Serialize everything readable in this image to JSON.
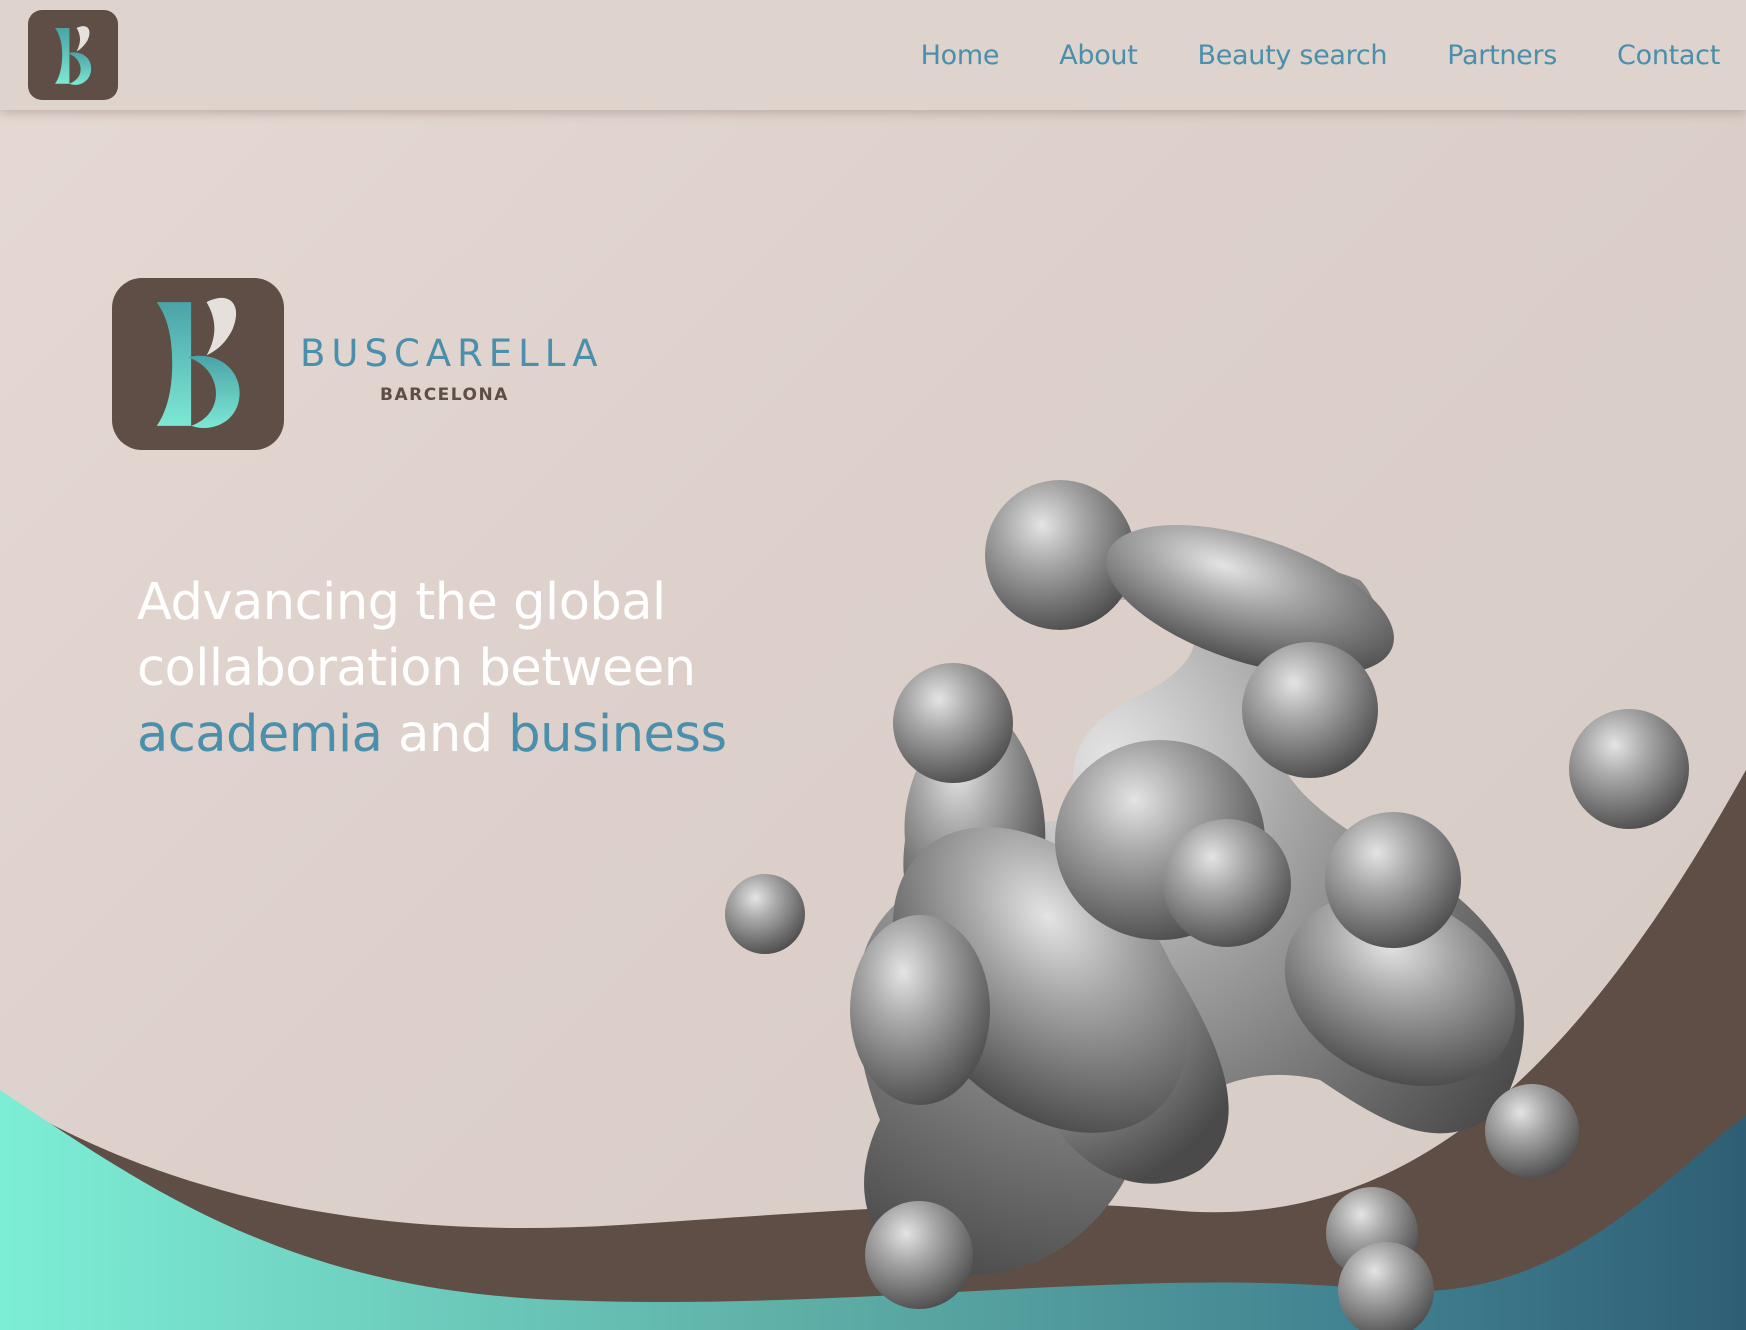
{
  "header": {
    "logo_icon": "buscarella-b-monogram-icon",
    "nav": [
      {
        "label": "Home"
      },
      {
        "label": "About"
      },
      {
        "label": "Beauty search"
      },
      {
        "label": "Partners"
      },
      {
        "label": "Contact"
      }
    ]
  },
  "hero": {
    "logo_icon": "buscarella-b-monogram-icon",
    "brand_name": "BUSCARELLA",
    "brand_sub": "BARCELONA",
    "headline": {
      "part1": "Advancing the global collaboration between ",
      "accent1": "academia",
      "part2": " and ",
      "accent2": "business"
    },
    "art": "abstract-grey-metaball-sculpture"
  },
  "colors": {
    "accent": "#4a8fab",
    "brown": "#5e4e45",
    "background": "#ddd0ca",
    "mint": "#7de8d4",
    "headline_text": "#ffffff"
  }
}
